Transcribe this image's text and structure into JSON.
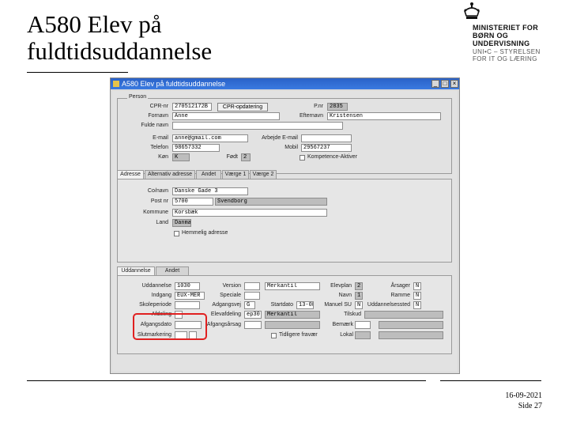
{
  "slide": {
    "title_line1": "A580 Elev på",
    "title_line2": "fuldtidsuddannelse",
    "logo": {
      "line1": "MINISTERIET FOR",
      "line2": "BØRN OG",
      "line3": "UNDERVISNING",
      "line4": "UNI•C – STYRELSEN",
      "line5": "FOR IT OG LÆRING"
    },
    "footer_date": "16-09-2021",
    "footer_page": "Side 27"
  },
  "window": {
    "title": "A580 Elev på fuldtidsuddannelse"
  },
  "person": {
    "legend": "Person",
    "cpr_label": "CPR-nr",
    "cpr_value": "270512172B",
    "cpr_button": "CPR-opdatering",
    "pnr_label": "P.nr",
    "pnr_value": "2835",
    "fornavn_label": "Fornavn",
    "fornavn_value": "Anne",
    "efternavn_label": "Efternavn",
    "efternavn_value": "Kristensen",
    "fuldenavn_label": "Fulde navn",
    "email_label": "E-mail",
    "email_value": "anne@gmail.com",
    "arb_email_label": "Arbejde E-mail",
    "telefon_label": "Telefon",
    "telefon_value": "98657332",
    "mobil_label": "Mobil",
    "mobil_value": "29567237",
    "kon_label": "Køn",
    "kon_value": "K",
    "fodsel_label": "Født",
    "fodsel_value": "2",
    "kompetence_label": "Kompetence-Aktiver"
  },
  "address_tabs": [
    "Adresse",
    "Alternativ adresse",
    "Andet",
    "Værge 1",
    "Værge 2"
  ],
  "address": {
    "coname_label": "Co/navn",
    "coname_value": "Danske Gade 3",
    "postnr_label": "Post nr",
    "postnr_value": "5700",
    "by_value": "Svendborg",
    "kommune_label": "Kommune",
    "kommune_value": "Korsbæk",
    "land_label": "Land",
    "land_value": "Danmark",
    "hemmelig_label": "Hemmelig adresse"
  },
  "edu_tabs": [
    "Uddannelse",
    "Andet"
  ],
  "education": {
    "udd_label": "Uddannelse",
    "udd_value": "1030",
    "version_label": "Version",
    "version_value": "",
    "betegnelse_value": "Merkantil",
    "elevplan_label": "Elevplan",
    "elevplan_value": "2",
    "aarsager_label": "Årsager",
    "aarsager_value": "N",
    "indgang_label": "Indgang",
    "indgang_value": "EUX-MER",
    "speciale_label": "Speciale",
    "nome_label": "Navn",
    "nome_value": "1",
    "ramme_label": "Ramme",
    "ramme_value": "N",
    "skoleperiode_label": "Skoleperiode",
    "adgangsvej_label": "Adgangsvej",
    "adgangsvej_value": "G",
    "startdato_label": "Startdato",
    "startdato_value": "13-08",
    "manuel_label": "Manuel SU",
    "manuel_value": "N",
    "uddsted_label": "Uddannelsessted",
    "uddsted_value": "N",
    "afdeling_label": "Afdeling",
    "afdeling_value": "",
    "elevafd_label": "Elevafdeling",
    "elevafd_value": "ep30",
    "elevafd_desc": "Merkantil",
    "tilskud_label": "Tilskud",
    "afgangsdato_label": "Afgangsdato",
    "afgangsaarsag_label": "Afgangsårsag",
    "bemaerk_label": "Bemærk",
    "slutmarkering_label": "Slutmarkering",
    "lokal_label": "Lokal",
    "tidligere_label": "Tidligere fravær"
  }
}
